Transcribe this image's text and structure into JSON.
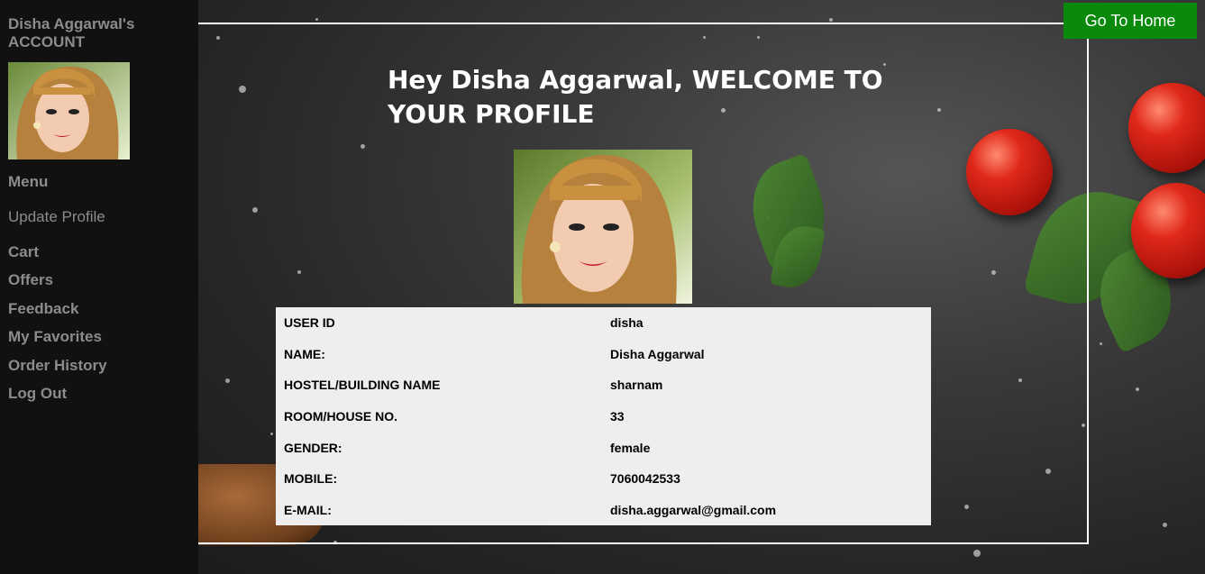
{
  "sidebar": {
    "account_title": "Disha Aggarwal's ACCOUNT",
    "menu_heading": "Menu",
    "items": [
      {
        "label": "Update Profile"
      },
      {
        "label": "Cart"
      },
      {
        "label": "Offers"
      },
      {
        "label": "Feedback"
      },
      {
        "label": "My Favorites"
      },
      {
        "label": "Order History"
      },
      {
        "label": "Log Out"
      }
    ]
  },
  "header": {
    "home_button": "Go To Home",
    "welcome": "Hey Disha Aggarwal, WELCOME TO YOUR PROFILE"
  },
  "profile": {
    "rows": [
      {
        "label": "USER ID",
        "value": "disha"
      },
      {
        "label": "NAME:",
        "value": "Disha Aggarwal"
      },
      {
        "label": "HOSTEL/BUILDING NAME",
        "value": "sharnam"
      },
      {
        "label": "ROOM/HOUSE NO.",
        "value": "33"
      },
      {
        "label": "GENDER:",
        "value": "female"
      },
      {
        "label": "MOBILE:",
        "value": "7060042533"
      },
      {
        "label": "E-MAIL:",
        "value": "disha.aggarwal@gmail.com"
      }
    ]
  },
  "colors": {
    "sidebar_bg": "#111111",
    "sidebar_text": "#8c8c8c",
    "home_button_bg": "#0a8a0a",
    "table_bg": "#eeeeee"
  },
  "icons": {
    "profile_photo": "user-photo"
  }
}
